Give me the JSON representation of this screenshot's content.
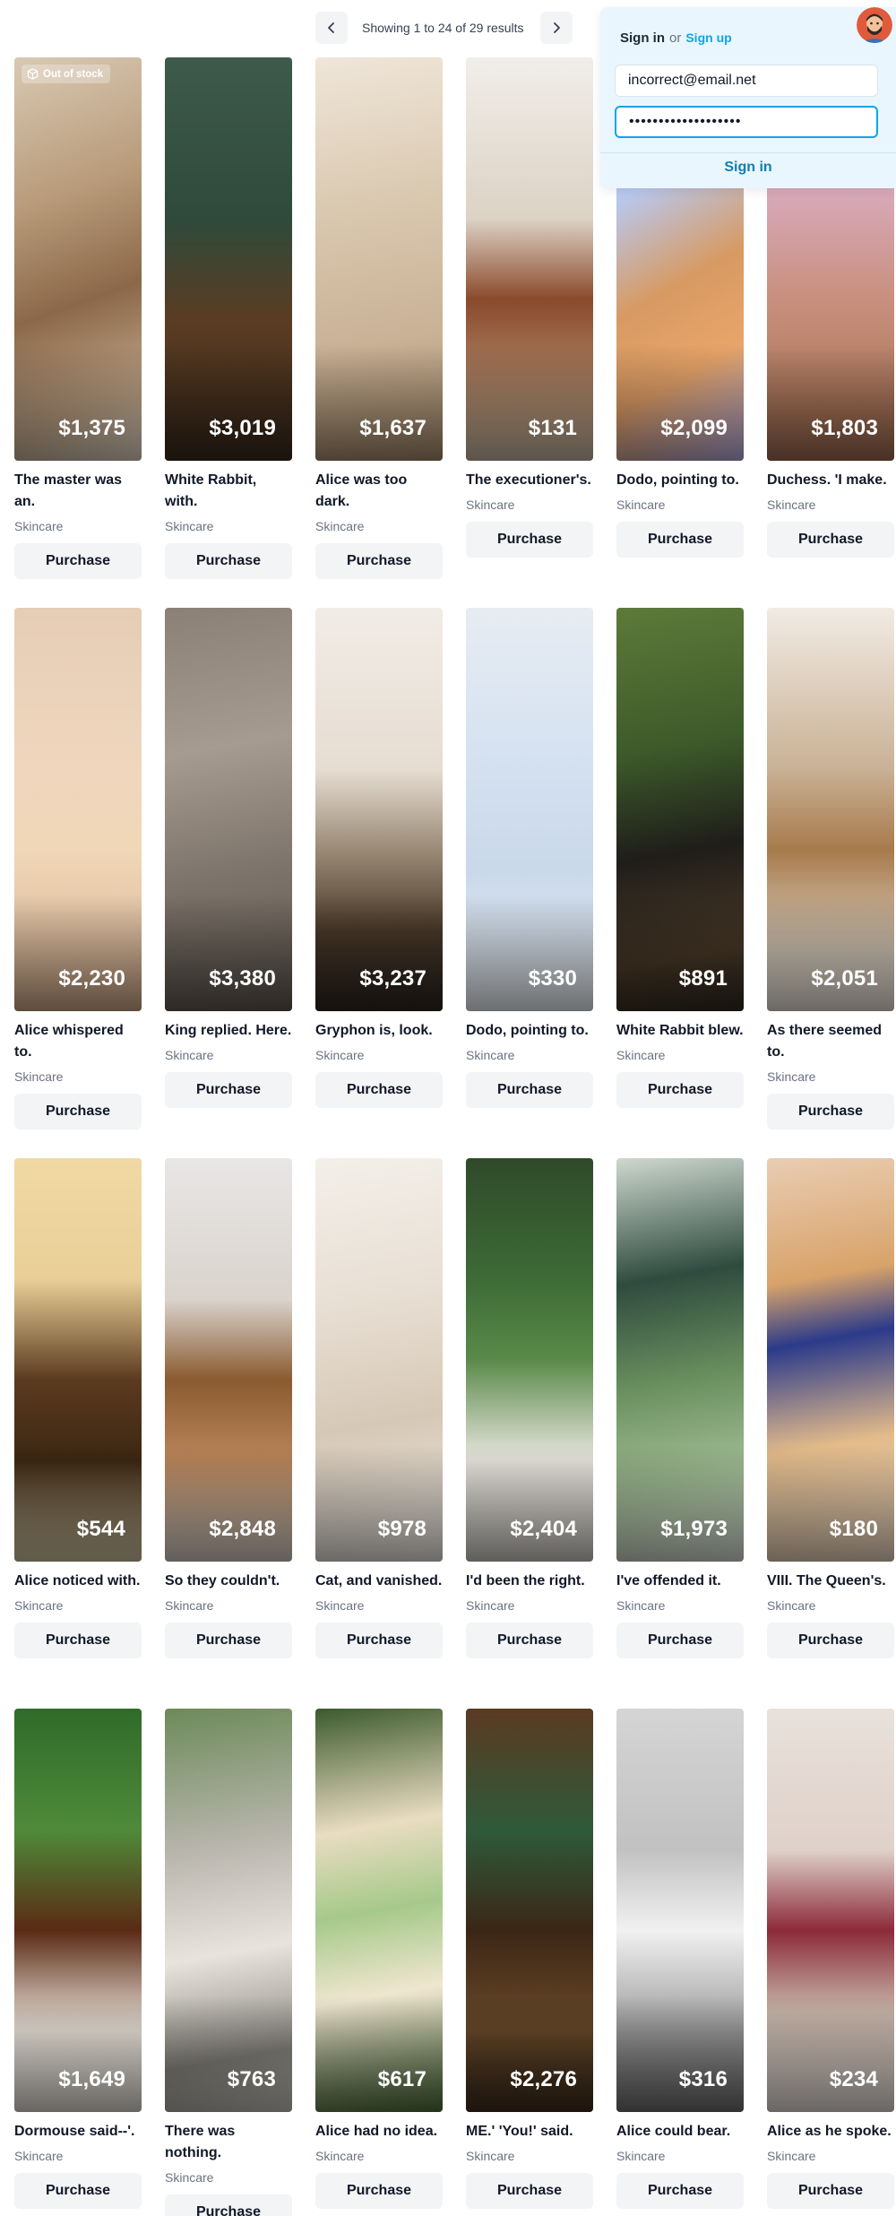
{
  "pagination": {
    "status_text": "Showing 1 to 24 of 29 results",
    "prev_icon": "chevron-left-icon",
    "next_icon": "chevron-right-icon"
  },
  "signin": {
    "title": "Sign in",
    "or_text": "or",
    "signup_label": "Sign up",
    "email_value": "incorrect@email.net",
    "password_value": "•••••••••••••••••••",
    "submit_label": "Sign in"
  },
  "products": [
    {
      "name": "The master was an.",
      "category": "Skincare",
      "price": "$1,375",
      "button": "Purchase",
      "badge": "Out of stock",
      "bg": "linear-gradient(160deg,#d9c9b3 0%,#b79a79 35%,#8b6849 60%,#c3a88b 85%,#e8dccb 100%)"
    },
    {
      "name": "White Rabbit, with.",
      "category": "Skincare",
      "price": "$3,019",
      "button": "Purchase",
      "bg": "linear-gradient(180deg,#3e5a4a 0%,#2f4a3b 40%,#5a3c22 65%,#3a2a1d 100%)"
    },
    {
      "name": "Alice was too dark.",
      "category": "Skincare",
      "price": "$1,637",
      "button": "Purchase",
      "bg": "linear-gradient(170deg,#efe6d9 0%,#d8c6ad 40%,#c9b195 70%,#a78c6d 100%)"
    },
    {
      "name": "The executioner's.",
      "category": "Skincare",
      "price": "$131",
      "button": "Purchase",
      "bg": "linear-gradient(180deg,#f1eee9 0%,#dcd2c5 40%,#8a4a2c 60%,#b38e6f 85%,#cbbba6 100%)"
    },
    {
      "name": "Dodo, pointing to.",
      "category": "Skincare",
      "price": "$2,099",
      "button": "Purchase",
      "bg": "linear-gradient(150deg,#a7c4e8 0%,#b9c8f0 30%,#d79a62 55%,#e8a56a 75%,#b8b0e6 100%)"
    },
    {
      "name": "Duchess. 'I make.",
      "category": "Skincare",
      "price": "$1,803",
      "button": "Purchase",
      "bg": "linear-gradient(180deg,#e8c7cf 0%,#d7a8b6 35%,#c88f7d 60%,#b07a5d 85%,#9e6b52 100%)"
    },
    {
      "name": "Alice whispered to.",
      "category": "Skincare",
      "price": "$2,230",
      "button": "Purchase",
      "bg": "linear-gradient(180deg,#e6cdb6 0%,#efd6bd 40%,#f0d7b7 60%,#e3c3a4 80%,#cfa989 100%)"
    },
    {
      "name": "King replied. Here.",
      "category": "Skincare",
      "price": "$3,380",
      "button": "Purchase",
      "bg": "linear-gradient(170deg,#8b8076 0%,#a69b90 35%,#7d746b 65%,#5f574f 100%)"
    },
    {
      "name": "Gryphon is, look.",
      "category": "Skincare",
      "price": "$3,237",
      "button": "Purchase",
      "bg": "linear-gradient(180deg,#f1ece6 0%,#e6ddd2 40%,#9a8a76 60%,#4b3a2a 80%,#2b2520 100%)"
    },
    {
      "name": "Dodo, pointing to.",
      "category": "Skincare",
      "price": "$330",
      "button": "Purchase",
      "bg": "linear-gradient(180deg,#e7ecf2 0%,#d6e2f1 35%,#c9d8ea 65%,#eef2f7 100%)"
    },
    {
      "name": "White Rabbit blew.",
      "category": "Skincare",
      "price": "$891",
      "button": "Purchase",
      "bg": "linear-gradient(170deg,#5d7a3a 0%,#3d5a2a 35%,#1f1d1a 60%,#4a3a28 85%,#2f2a21 100%)"
    },
    {
      "name": "As there seemed to.",
      "category": "Skincare",
      "price": "$2,051",
      "button": "Purchase",
      "bg": "linear-gradient(180deg,#f1ebe4 0%,#c9b195 40%,#a77a4c 60%,#d9cdbd 85%,#efe8df 100%)"
    },
    {
      "name": "Alice noticed with.",
      "category": "Skincare",
      "price": "$544",
      "button": "Purchase",
      "bg": "linear-gradient(180deg,#f1d9a5 0%,#e9cf97 30%,#5b3a1f 55%,#3c2712 75%,#d7c9a5 100%)"
    },
    {
      "name": "So they couldn't.",
      "category": "Skincare",
      "price": "$2,848",
      "button": "Purchase",
      "bg": "linear-gradient(180deg,#e8e6e6 0%,#d9d3cc 35%,#8a5a30 55%,#b9865a 75%,#d8d2cb 100%)"
    },
    {
      "name": "Cat, and vanished.",
      "category": "Skincare",
      "price": "$978",
      "button": "Purchase",
      "bg": "linear-gradient(170deg,#f3efe9 0%,#e8dfd4 35%,#d6c8b6 65%,#f1ede8 100%)"
    },
    {
      "name": "I'd been the right.",
      "category": "Skincare",
      "price": "$2,404",
      "button": "Purchase",
      "bg": "linear-gradient(180deg,#2f4a2a 0%,#3d6b36 30%,#5a8a4a 50%,#e9e6df 75%,#d3cfc8 100%)"
    },
    {
      "name": "I've offended it.",
      "category": "Skincare",
      "price": "$1,973",
      "button": "Purchase",
      "bg": "linear-gradient(170deg,#cfd8cf 0%,#2f4b3f 30%,#6a8f5e 55%,#a6c19a 80%,#dfe5dc 100%)"
    },
    {
      "name": "VIII. The Queen's.",
      "category": "Skincare",
      "price": "$180",
      "button": "Purchase",
      "bg": "linear-gradient(170deg,#e9cdb3 0%,#d8a36a 30%,#2b3a8a 45%,#e3bb8a 70%,#f0dcc7 100%)"
    },
    {
      "name": "Dormouse said--'.",
      "category": "Skincare",
      "price": "$1,649",
      "button": "Purchase",
      "bg": "linear-gradient(180deg,#2f6b2a 0%,#4f8a3a 30%,#5a2a14 55%,#efe8df 80%,#e6e1da 100%)"
    },
    {
      "name": "There was nothing.",
      "category": "Skincare",
      "price": "$763",
      "button": "Purchase",
      "bg": "linear-gradient(170deg,#6d8a5a 0%,#b9b6ae 35%,#e8e4dd 60%,#8d8a83 85%,#cfcbc3 100%)"
    },
    {
      "name": "Alice had no idea.",
      "category": "Skincare",
      "price": "$617",
      "button": "Purchase",
      "bg": "linear-gradient(170deg,#3c5a2c 0%,#e9dcc2 30%,#a6c98a 50%,#efe6d0 70%,#4d6e3a 100%)"
    },
    {
      "name": "ME.' 'You!' said.",
      "category": "Skincare",
      "price": "$2,276",
      "button": "Purchase",
      "bg": "linear-gradient(180deg,#5a3a22 0%,#2f5a3a 30%,#3b2616 55%,#6a4a2a 80%,#3d2c1e 100%)"
    },
    {
      "name": "Alice could bear.",
      "category": "Skincare",
      "price": "$316",
      "button": "Purchase",
      "bg": "linear-gradient(180deg,#d5d5d5 0%,#c1c1c1 35%,#f1f1f1 55%,#9c9c9c 80%,#6e6e6e 100%)"
    },
    {
      "name": "Alice as he spoke.",
      "category": "Skincare",
      "price": "$234",
      "button": "Purchase",
      "bg": "linear-gradient(180deg,#e8e1db 0%,#dfd1c9 35%,#8c2a3a 55%,#c7b4a8 75%,#e9e3de 100%)"
    }
  ],
  "icons": {
    "out_of_stock": "box-icon",
    "avatar": "user-avatar"
  }
}
